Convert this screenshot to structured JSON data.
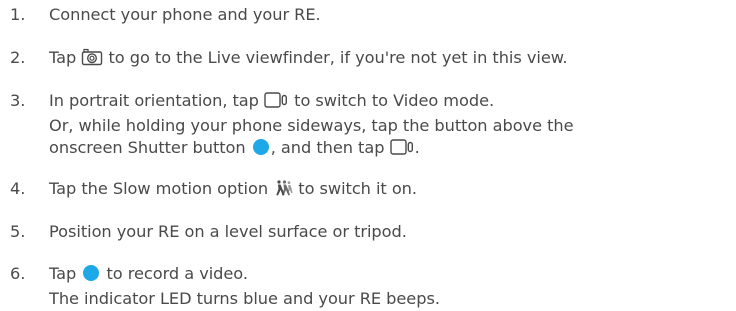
{
  "steps": [
    {
      "number": "1.",
      "text": "Connect your phone and your RE."
    },
    {
      "number": "2.",
      "before": "Tap",
      "icon": "camera-icon",
      "after": "to go to the Live viewfinder, if you're not yet in this view."
    },
    {
      "number": "3.",
      "before": "In portrait orientation, tap",
      "icon": "video-mode-icon",
      "after": "to switch to Video mode."
    },
    {
      "note_before": "Or, while holding your phone sideways, tap the button above the"
    },
    {
      "note2_before": "onscreen Shutter button",
      "icon1": "shutter-button-icon",
      "note2_middle": ", and then tap",
      "icon2": "video-mode-icon",
      "note2_after": "."
    },
    {
      "number": "4.",
      "before": "Tap the Slow motion option",
      "icon": "slow-motion-icon",
      "after": "to switch it on."
    },
    {
      "number": "5.",
      "text": "Position your RE on a level surface or tripod."
    },
    {
      "number": "6.",
      "before": "Tap",
      "icon": "shutter-button-icon",
      "after": "to record a video."
    },
    {
      "note": "The indicator LED turns blue and your RE beeps."
    }
  ],
  "colors": {
    "text": "#4a4a4a",
    "shutter": "#1fa8e8"
  }
}
